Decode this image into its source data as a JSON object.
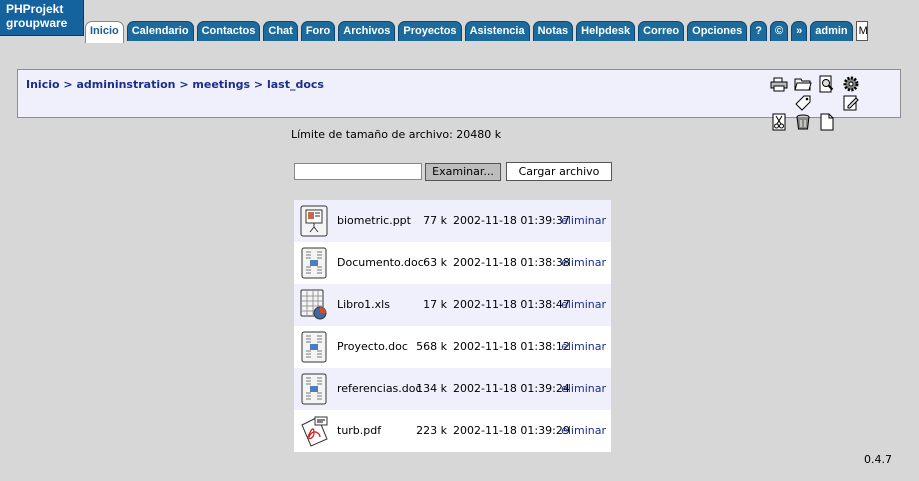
{
  "app": {
    "logo_line1": "PHProjekt",
    "logo_line2": "groupware"
  },
  "tabs": [
    {
      "label": "Inicio",
      "active": true
    },
    {
      "label": "Calendario"
    },
    {
      "label": "Contactos"
    },
    {
      "label": "Chat"
    },
    {
      "label": "Foro"
    },
    {
      "label": "Archivos"
    },
    {
      "label": "Proyectos"
    },
    {
      "label": "Asistencia"
    },
    {
      "label": "Notas"
    },
    {
      "label": "Helpdesk"
    },
    {
      "label": "Correo"
    },
    {
      "label": "Opciones"
    },
    {
      "label": "?"
    },
    {
      "label": "©"
    },
    {
      "label": "»"
    },
    {
      "label": "admin"
    }
  ],
  "tab_cut_label": "M",
  "breadcrumb": {
    "items": [
      "Inicio",
      "admininstration",
      "meetings",
      "last_docs"
    ],
    "separator": ">"
  },
  "toolbar_icons": [
    "print-icon",
    "open-folder-icon",
    "search-icon",
    "settings-icon",
    "tag-icon",
    "edit-icon",
    "scissors-icon",
    "trash-icon",
    "new-document-icon"
  ],
  "upload": {
    "limit_text": "Límite de tamaño de archivo: 20480 k",
    "file_value": "",
    "browse_label": "Examinar...",
    "upload_label": "Cargar archivo"
  },
  "files": [
    {
      "icon": "presentation-file-icon",
      "name": "biometric.ppt",
      "size": "77 k",
      "date": "2002-11-18 01:39:37",
      "action": "eliminar"
    },
    {
      "icon": "document-file-icon",
      "name": "Documento.doc",
      "size": "63 k",
      "date": "2002-11-18 01:38:38",
      "action": "eliminar"
    },
    {
      "icon": "spreadsheet-file-icon",
      "name": "Libro1.xls",
      "size": "17 k",
      "date": "2002-11-18 01:38:47",
      "action": "eliminar"
    },
    {
      "icon": "document-file-icon",
      "name": "Proyecto.doc",
      "size": "568 k",
      "date": "2002-11-18 01:38:12",
      "action": "eliminar"
    },
    {
      "icon": "document-file-icon",
      "name": "referencias.doc",
      "size": "134 k",
      "date": "2002-11-18 01:39:24",
      "action": "eliminar"
    },
    {
      "icon": "pdf-file-icon",
      "name": "turb.pdf",
      "size": "223 k",
      "date": "2002-11-18 01:39:29",
      "action": "eliminar"
    }
  ],
  "footer": {
    "version": "0.4.7"
  },
  "colors": {
    "tab_bg": "#1c6b9c",
    "logo_bg": "#14629e",
    "panel_bg": "#eff0fb",
    "link": "#1a2e8a",
    "page_bg": "#d7d7d7"
  }
}
